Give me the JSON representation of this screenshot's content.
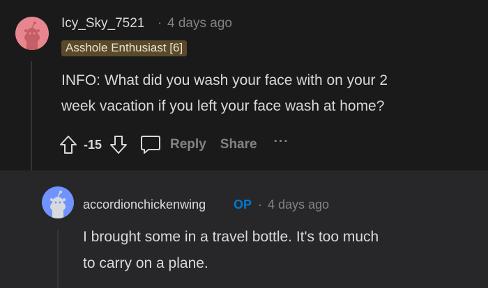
{
  "comment1": {
    "username": "Icy_Sky_7521",
    "separator": "·",
    "timestamp": "4 days ago",
    "flair": "Asshole Enthusiast [6]",
    "body_line1": "INFO: What did you wash your face with on your 2",
    "body_line2": "week vacation if you left your face wash at home?",
    "score": "-15",
    "reply_label": "Reply",
    "share_label": "Share",
    "more_label": "···",
    "avatar_color": "#e8868f"
  },
  "comment2": {
    "username": "accordionchickenwing",
    "op_badge": "OP",
    "separator": "·",
    "timestamp": "4 days ago",
    "body_line1": "I brought some in a travel bottle. It's too much",
    "body_line2": "to carry on a plane.",
    "avatar_color": "#7193ff"
  },
  "icons": [
    "upvote-icon",
    "downvote-icon",
    "comment-icon",
    "more-options-icon",
    "snoo-avatar-icon"
  ]
}
